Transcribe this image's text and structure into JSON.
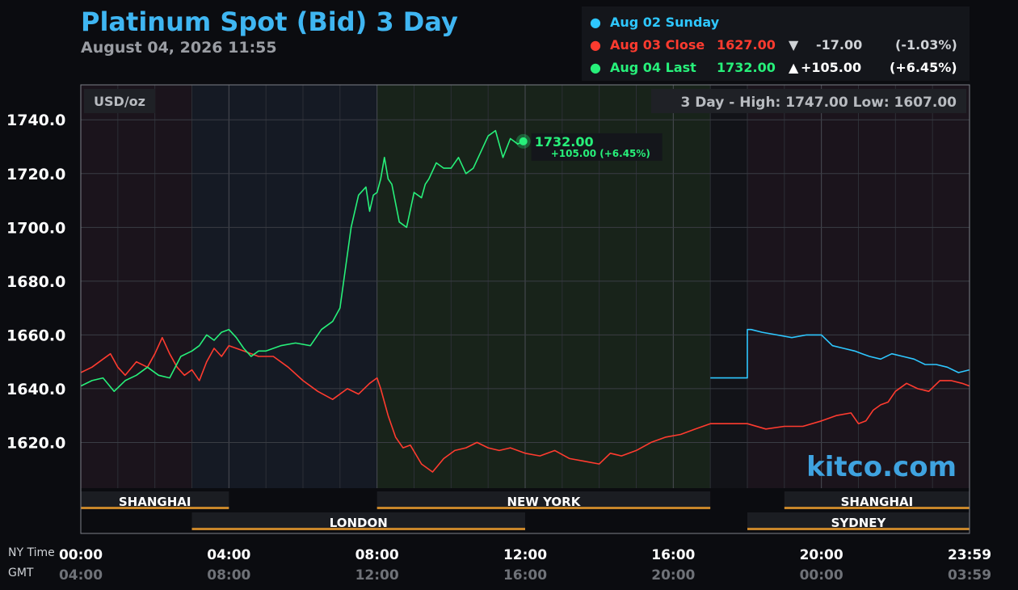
{
  "header": {
    "title": "Platinum Spot (Bid) 3 Day",
    "subtitle": "August 04, 2026 11:55"
  },
  "legend": [
    {
      "label": "Aug 02 Sunday",
      "price": "",
      "arrow": "",
      "change": "",
      "pct": "",
      "color": "#2ec7ff"
    },
    {
      "label": "Aug 03 Close",
      "price": "1627.00",
      "arrow": "▼",
      "change": "-17.00",
      "pct": "(-1.03%)",
      "color": "#ff3b2f"
    },
    {
      "label": "Aug 04 Last",
      "price": "1732.00",
      "arrow": "▲",
      "change": "+105.00",
      "pct": "(+6.45%)",
      "color": "#27f07a"
    }
  ],
  "chart_data": {
    "type": "line",
    "unit_label": "USD/oz",
    "high_low_label": "3 Day - High: 1747.00  Low: 1607.00",
    "watermark": "kitco.com",
    "last_price_label": "1732.00",
    "last_change_label": "+105.00 (+6.45%)",
    "ylim": [
      1603,
      1753
    ],
    "yticks": [
      1620,
      1640,
      1660,
      1680,
      1700,
      1720,
      1740
    ],
    "ytick_labels": [
      "1620.0",
      "1640.0",
      "1660.0",
      "1680.0",
      "1700.0",
      "1720.0",
      "1740.0"
    ],
    "xlim": [
      0,
      24
    ],
    "xticks": [
      0,
      4,
      8,
      12,
      16,
      20,
      24
    ],
    "xtick_labels_ny": [
      "00:00",
      "04:00",
      "08:00",
      "12:00",
      "16:00",
      "20:00",
      "23:59"
    ],
    "xtick_labels_gmt": [
      "04:00",
      "08:00",
      "12:00",
      "16:00",
      "20:00",
      "00:00",
      "03:59"
    ],
    "axis_row_labels": [
      "NY Time",
      "GMT"
    ],
    "sessions_top": [
      {
        "name": "SHANGHAI",
        "start": 0,
        "end": 4
      },
      {
        "name": "NEW YORK",
        "start": 8,
        "end": 17
      },
      {
        "name": "SHANGHAI",
        "start": 19,
        "end": 24
      }
    ],
    "sessions_bottom": [
      {
        "name": "LONDON",
        "start": 3,
        "end": 12
      },
      {
        "name": "SYDNEY",
        "start": 18,
        "end": 24
      }
    ],
    "series": [
      {
        "name": "Aug 02 Sunday",
        "color": "#2ec7ff",
        "x": [
          17.0,
          18.0,
          18.0,
          18.1,
          18.4,
          18.8,
          19.2,
          19.6,
          20.0,
          20.3,
          20.6,
          20.9,
          21.1,
          21.3,
          21.6,
          21.9,
          22.2,
          22.5,
          22.8,
          23.1,
          23.4,
          23.7,
          24.0
        ],
        "y": [
          1644,
          1644,
          1662,
          1662,
          1661,
          1660,
          1659,
          1660,
          1660,
          1656,
          1655,
          1654,
          1653,
          1652,
          1651,
          1653,
          1652,
          1651,
          1649,
          1649,
          1648,
          1646,
          1647
        ]
      },
      {
        "name": "Aug 03 Close",
        "color": "#ff3b2f",
        "x": [
          0.0,
          0.3,
          0.6,
          0.8,
          1.0,
          1.2,
          1.5,
          1.8,
          2.0,
          2.2,
          2.4,
          2.6,
          2.8,
          3.0,
          3.2,
          3.4,
          3.6,
          3.8,
          4.0,
          4.4,
          4.8,
          5.2,
          5.6,
          6.0,
          6.4,
          6.8,
          7.2,
          7.5,
          7.8,
          8.0,
          8.1,
          8.3,
          8.5,
          8.7,
          8.9,
          9.2,
          9.5,
          9.8,
          10.1,
          10.4,
          10.7,
          11.0,
          11.3,
          11.6,
          12.0,
          12.4,
          12.8,
          13.2,
          13.6,
          14.0,
          14.3,
          14.6,
          15.0,
          15.4,
          15.8,
          16.2,
          16.6,
          17.0,
          17.5,
          18.0,
          18.5,
          19.0,
          19.5,
          20.0,
          20.4,
          20.8,
          21.0,
          21.2,
          21.4,
          21.6,
          21.8,
          22.0,
          22.3,
          22.6,
          22.9,
          23.2,
          23.5,
          23.8,
          24.0
        ],
        "y": [
          1646,
          1648,
          1651,
          1653,
          1648,
          1645,
          1650,
          1648,
          1653,
          1659,
          1653,
          1648,
          1645,
          1647,
          1643,
          1650,
          1655,
          1652,
          1656,
          1654,
          1652,
          1652,
          1648,
          1643,
          1639,
          1636,
          1640,
          1638,
          1642,
          1644,
          1640,
          1630,
          1622,
          1618,
          1619,
          1612,
          1609,
          1614,
          1617,
          1618,
          1620,
          1618,
          1617,
          1618,
          1616,
          1615,
          1617,
          1614,
          1613,
          1612,
          1616,
          1615,
          1617,
          1620,
          1622,
          1623,
          1625,
          1627,
          1627,
          1627,
          1625,
          1626,
          1626,
          1628,
          1630,
          1631,
          1627,
          1628,
          1632,
          1634,
          1635,
          1639,
          1642,
          1640,
          1639,
          1643,
          1643,
          1642,
          1641
        ]
      },
      {
        "name": "Aug 04 Last",
        "color": "#27f07a",
        "x": [
          0.0,
          0.3,
          0.6,
          0.9,
          1.2,
          1.5,
          1.8,
          2.1,
          2.4,
          2.7,
          3.0,
          3.2,
          3.4,
          3.6,
          3.8,
          4.0,
          4.2,
          4.4,
          4.6,
          4.8,
          5.0,
          5.4,
          5.8,
          6.2,
          6.5,
          6.8,
          7.0,
          7.1,
          7.3,
          7.5,
          7.7,
          7.8,
          7.9,
          8.0,
          8.1,
          8.2,
          8.3,
          8.4,
          8.6,
          8.8,
          9.0,
          9.2,
          9.3,
          9.4,
          9.6,
          9.8,
          10.0,
          10.2,
          10.4,
          10.6,
          10.8,
          11.0,
          11.2,
          11.4,
          11.6,
          11.8,
          11.95
        ],
        "y": [
          1641,
          1643,
          1644,
          1639,
          1643,
          1645,
          1648,
          1645,
          1644,
          1652,
          1654,
          1656,
          1660,
          1658,
          1661,
          1662,
          1659,
          1655,
          1652,
          1654,
          1654,
          1656,
          1657,
          1656,
          1662,
          1665,
          1670,
          1680,
          1700,
          1712,
          1715,
          1706,
          1712,
          1713,
          1718,
          1726,
          1718,
          1716,
          1702,
          1700,
          1713,
          1711,
          1716,
          1718,
          1724,
          1722,
          1722,
          1726,
          1720,
          1722,
          1728,
          1734,
          1736,
          1726,
          1733,
          1731,
          1732
        ]
      }
    ]
  }
}
